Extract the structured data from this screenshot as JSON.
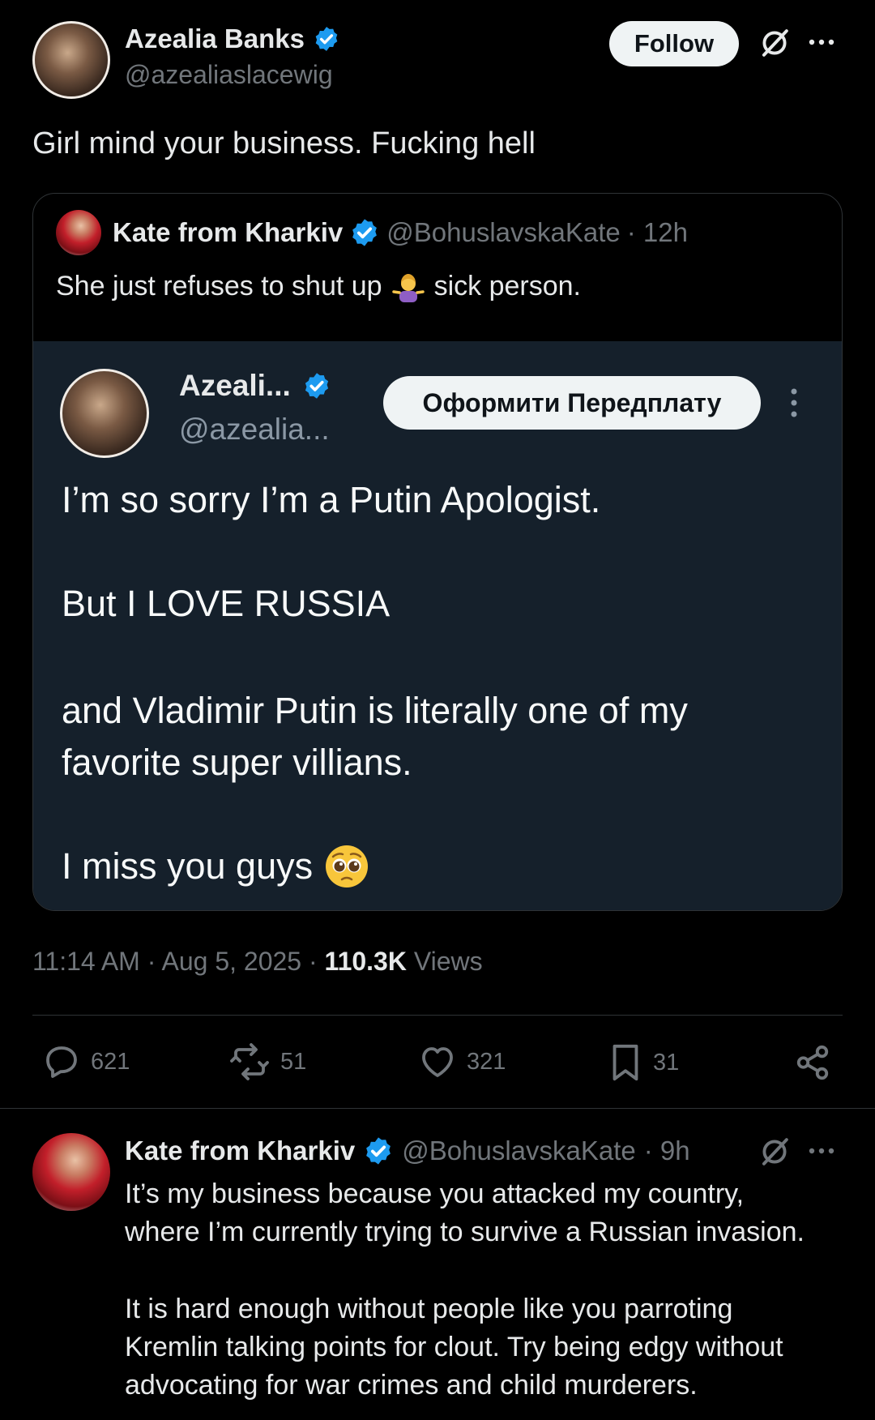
{
  "main_tweet": {
    "author_name": "Azealia Banks",
    "handle": "@azealiaslacewig",
    "follow_label": "Follow",
    "text": "Girl mind your business. Fucking hell",
    "timestamp": "11:14 AM · Aug 5, 2025 · ",
    "views_count": "110.3K",
    "views_label": " Views"
  },
  "quoted_tweet": {
    "author_name": "Kate from Kharkiv",
    "handle": "@BohuslavskaKate",
    "time": "· 12h",
    "text_before_emoji": "She just refuses to shut up",
    "text_after_emoji": "sick person."
  },
  "embedded_card": {
    "author_name": "Azeali...",
    "handle": "@azealia...",
    "subscribe_label": "Оформити Передплату",
    "line1": "I’m so sorry I’m a Putin Apologist.",
    "line2": "But I LOVE RUSSIA",
    "line3": "and Vladimir Putin is literally one of my",
    "line4": "favorite super villians.",
    "line5": "I miss you guys"
  },
  "actions": {
    "replies": "621",
    "reposts": "51",
    "likes": "321",
    "bookmarks": "31"
  },
  "reply": {
    "author_name": "Kate from Kharkiv",
    "handle": "@BohuslavskaKate",
    "time": "· 9h",
    "p1_line1": "It’s my business because you attacked my country,",
    "p1_line2": "where I’m currently trying to survive a Russian invasion.",
    "p2_line1": "It is hard enough without people like you parroting",
    "p2_line2": "Kremlin talking points for clout. Try being edgy without",
    "p2_line3": "advocating for war crimes and child murderers."
  },
  "colors": {
    "background": "#000000",
    "card": "#15202b",
    "verified": "#1d9bf0",
    "muted": "#71767b",
    "text": "#e7e9ea"
  },
  "icons": [
    "verified-badge-icon",
    "grok-icon",
    "more-icon",
    "vertical-more-icon",
    "reply-icon",
    "repost-icon",
    "like-icon",
    "bookmark-icon",
    "share-icon",
    "person-shrugging-emoji",
    "pleading-face-emoji"
  ]
}
